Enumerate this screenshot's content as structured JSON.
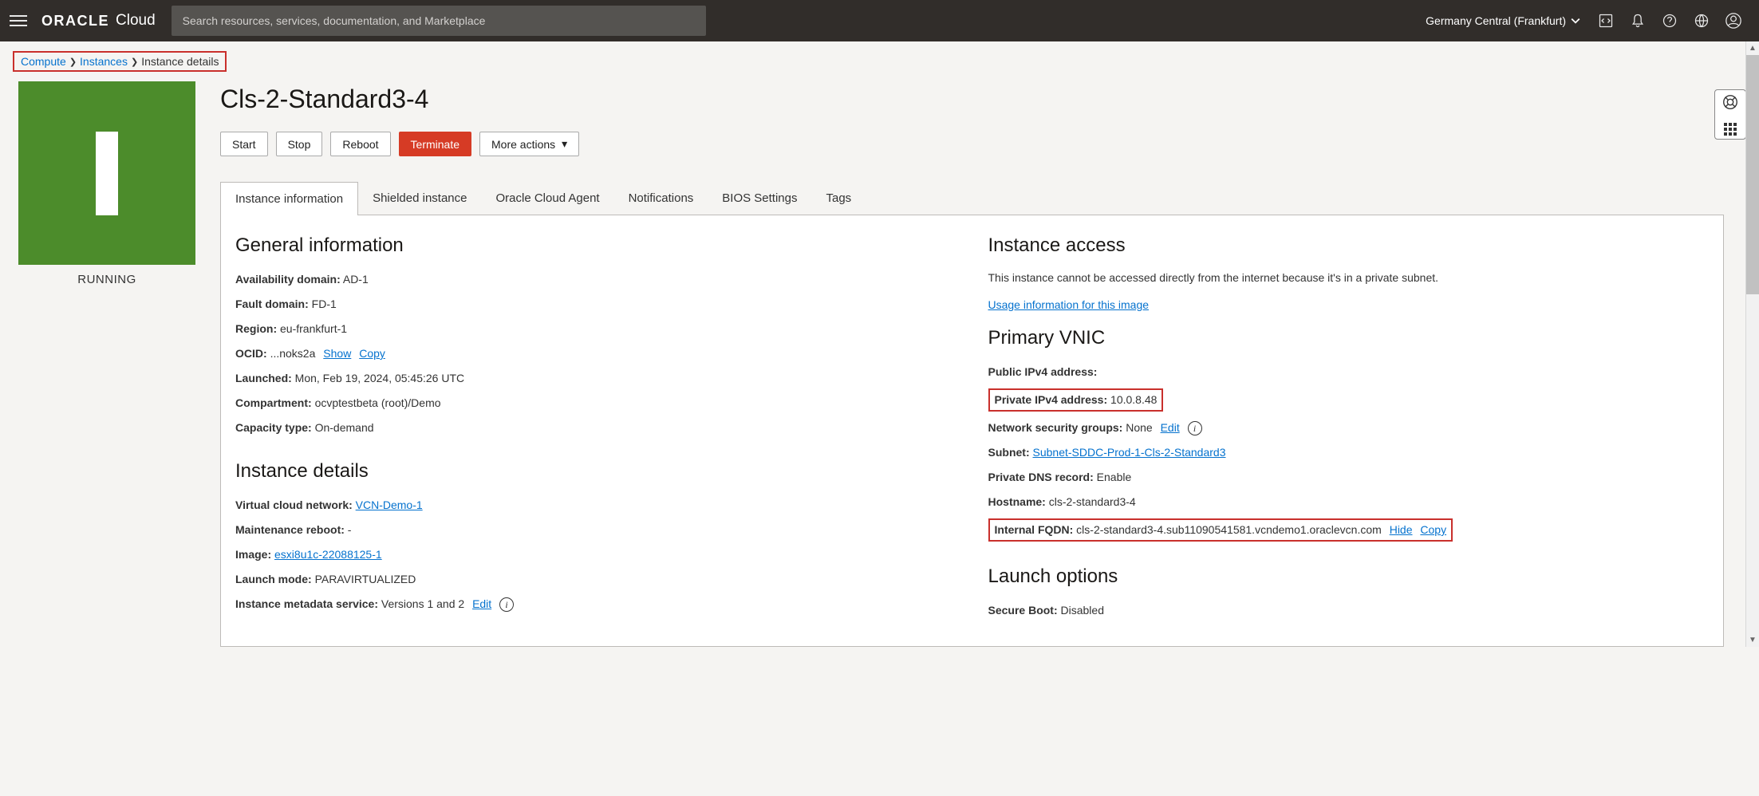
{
  "header": {
    "brand_bold": "ORACLE",
    "brand_light": "Cloud",
    "search_placeholder": "Search resources, services, documentation, and Marketplace",
    "region": "Germany Central (Frankfurt)"
  },
  "breadcrumb": {
    "compute": "Compute",
    "instances": "Instances",
    "current": "Instance details"
  },
  "page": {
    "title": "Cls-2-Standard3-4",
    "status": "RUNNING"
  },
  "actions": {
    "start": "Start",
    "stop": "Stop",
    "reboot": "Reboot",
    "terminate": "Terminate",
    "more": "More actions"
  },
  "tabs": {
    "info": "Instance information",
    "shielded": "Shielded instance",
    "agent": "Oracle Cloud Agent",
    "notifications": "Notifications",
    "bios": "BIOS Settings",
    "tags": "Tags"
  },
  "general": {
    "heading": "General information",
    "ad_k": "Availability domain:",
    "ad_v": "AD-1",
    "fd_k": "Fault domain:",
    "fd_v": "FD-1",
    "region_k": "Region:",
    "region_v": "eu-frankfurt-1",
    "ocid_k": "OCID:",
    "ocid_v": "...noks2a",
    "show": "Show",
    "copy": "Copy",
    "launched_k": "Launched:",
    "launched_v": "Mon, Feb 19, 2024, 05:45:26 UTC",
    "compartment_k": "Compartment:",
    "compartment_v": "ocvptestbeta (root)/Demo",
    "capacity_k": "Capacity type:",
    "capacity_v": "On-demand"
  },
  "details": {
    "heading": "Instance details",
    "vcn_k": "Virtual cloud network:",
    "vcn_v": "VCN-Demo-1",
    "maint_k": "Maintenance reboot:",
    "maint_v": "-",
    "image_k": "Image:",
    "image_v": "esxi8u1c-22088125-1",
    "launch_k": "Launch mode:",
    "launch_v": "PARAVIRTUALIZED",
    "meta_k": "Instance metadata service:",
    "meta_v": "Versions 1 and 2",
    "edit": "Edit"
  },
  "access": {
    "heading": "Instance access",
    "desc": "This instance cannot be accessed directly from the internet because it's in a private subnet.",
    "usage_link": "Usage information for this image"
  },
  "vnic": {
    "heading": "Primary VNIC",
    "pub_k": "Public IPv4 address:",
    "pub_v": "",
    "priv_k": "Private IPv4 address:",
    "priv_v": "10.0.8.48",
    "nsg_k": "Network security groups:",
    "nsg_v": "None",
    "edit": "Edit",
    "subnet_k": "Subnet:",
    "subnet_v": "Subnet-SDDC-Prod-1-Cls-2-Standard3",
    "dns_k": "Private DNS record:",
    "dns_v": "Enable",
    "hostname_k": "Hostname:",
    "hostname_v": "cls-2-standard3-4",
    "fqdn_k": "Internal FQDN:",
    "fqdn_v": "cls-2-standard3-4.sub11090541581.vcndemo1.oraclevcn.com",
    "hide": "Hide",
    "copy": "Copy"
  },
  "launch_options": {
    "heading": "Launch options",
    "secure_k": "Secure Boot:",
    "secure_v": "Disabled"
  }
}
